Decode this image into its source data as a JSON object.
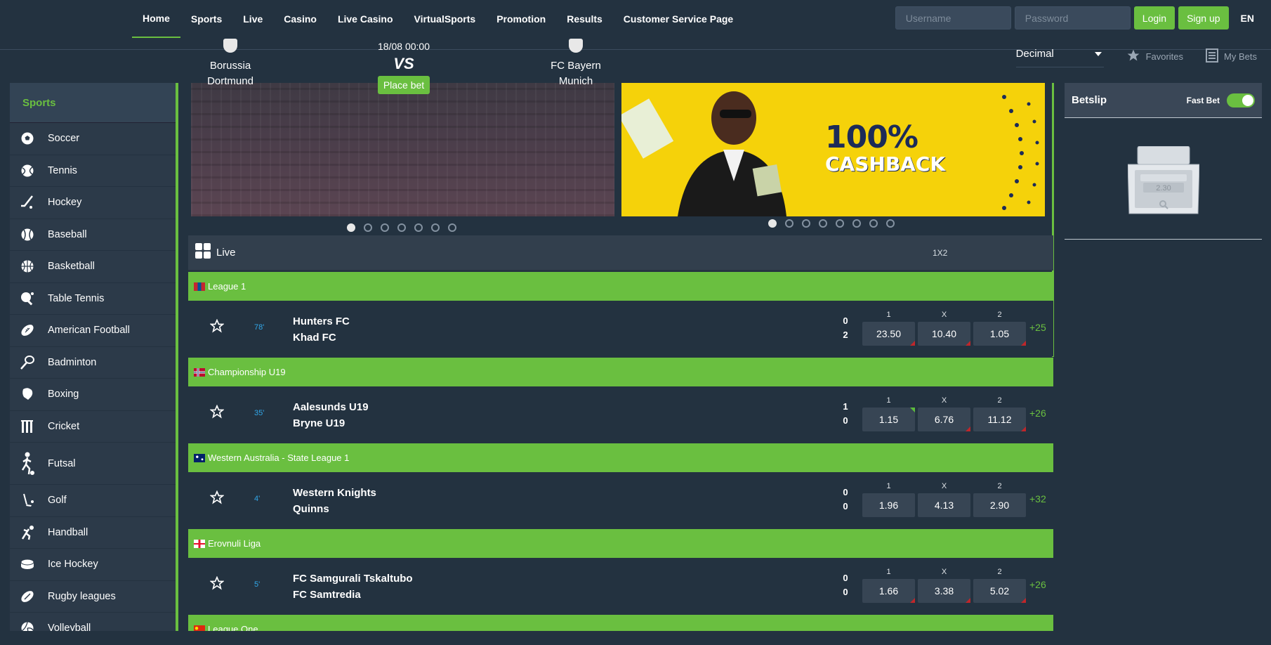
{
  "nav": {
    "items": [
      "Home",
      "Sports",
      "Live",
      "Casino",
      "Live Casino",
      "VirtualSports",
      "Promotion",
      "Results",
      "Customer Service Page"
    ],
    "active": "Home"
  },
  "auth": {
    "username_placeholder": "Username",
    "password_placeholder": "Password",
    "login_label": "Login",
    "signup_label": "Sign up",
    "language": "EN"
  },
  "subheader": {
    "odds_format": "Decimal",
    "favorites_label": "Favorites",
    "mybets_label": "My Bets"
  },
  "sidebar": {
    "title": "Sports",
    "items": [
      {
        "label": "Soccer",
        "icon": "soccer-icon"
      },
      {
        "label": "Tennis",
        "icon": "tennis-icon"
      },
      {
        "label": "Hockey",
        "icon": "hockey-icon"
      },
      {
        "label": "Baseball",
        "icon": "baseball-icon"
      },
      {
        "label": "Basketball",
        "icon": "basketball-icon"
      },
      {
        "label": "Table Tennis",
        "icon": "table-tennis-icon"
      },
      {
        "label": "American Football",
        "icon": "american-football-icon"
      },
      {
        "label": "Badminton",
        "icon": "badminton-icon"
      },
      {
        "label": "Boxing",
        "icon": "boxing-icon"
      },
      {
        "label": "Cricket",
        "icon": "cricket-icon"
      },
      {
        "label": "Futsal",
        "icon": "futsal-icon"
      },
      {
        "label": "Golf",
        "icon": "golf-icon"
      },
      {
        "label": "Handball",
        "icon": "handball-icon"
      },
      {
        "label": "Ice Hockey",
        "icon": "ice-hockey-icon"
      },
      {
        "label": "Rugby leagues",
        "icon": "rugby-icon"
      },
      {
        "label": "Volleyball",
        "icon": "volleyball-icon"
      }
    ]
  },
  "banner1": {
    "home_team": "Borussia Dortmund",
    "home_team_line1": "Borussia",
    "home_team_line2": "Dortmund",
    "away_team_line1": "FC Bayern",
    "away_team_line2": "Munich",
    "date": "18/08 00:00",
    "vs": "VS",
    "cta": "Place bet",
    "slides": 7,
    "active_slide": 0
  },
  "banner2": {
    "headline": "100%",
    "subline": "CASHBACK",
    "slides": 8,
    "active_slide": 0
  },
  "live": {
    "title": "Live",
    "market": "1X2",
    "odds_labels": [
      "1",
      "X",
      "2"
    ],
    "leagues": [
      {
        "name": "League 1",
        "flag": "mn",
        "match": {
          "minute": "78'",
          "home": "Hunters FC",
          "away": "Khad FC",
          "home_score": "0",
          "away_score": "2",
          "odds": [
            "23.50",
            "10.40",
            "1.05"
          ],
          "more": "+25"
        }
      },
      {
        "name": "Championship U19",
        "flag": "no",
        "match": {
          "minute": "35'",
          "home": "Aalesunds U19",
          "away": "Bryne U19",
          "home_score": "1",
          "away_score": "0",
          "odds": [
            "1.15",
            "6.76",
            "11.12"
          ],
          "more": "+26"
        }
      },
      {
        "name": "Western Australia - State League 1",
        "flag": "au",
        "match": {
          "minute": "4'",
          "home": "Western Knights",
          "away": "Quinns",
          "home_score": "0",
          "away_score": "0",
          "odds": [
            "1.96",
            "4.13",
            "2.90"
          ],
          "more": "+32"
        }
      },
      {
        "name": "Erovnuli Liga",
        "flag": "ge",
        "match": {
          "minute": "5'",
          "home": "FC Samgurali Tskaltubo",
          "away": "FC Samtredia",
          "home_score": "0",
          "away_score": "0",
          "odds": [
            "1.66",
            "3.38",
            "5.02"
          ],
          "more": "+26"
        }
      },
      {
        "name": "League One",
        "flag": "cn"
      }
    ]
  },
  "betslip": {
    "title": "Betslip",
    "fast_bet_label": "Fast Bet",
    "fast_bet_on": true,
    "empty_value": "2.30"
  },
  "colors": {
    "accent": "#6abf40",
    "background": "#233240",
    "panel": "#2c3a49",
    "minute": "#32a7e8",
    "odds_down": "#c0262a",
    "odds_up": "#5cbb3c",
    "banner_yellow": "#f5d20a"
  }
}
